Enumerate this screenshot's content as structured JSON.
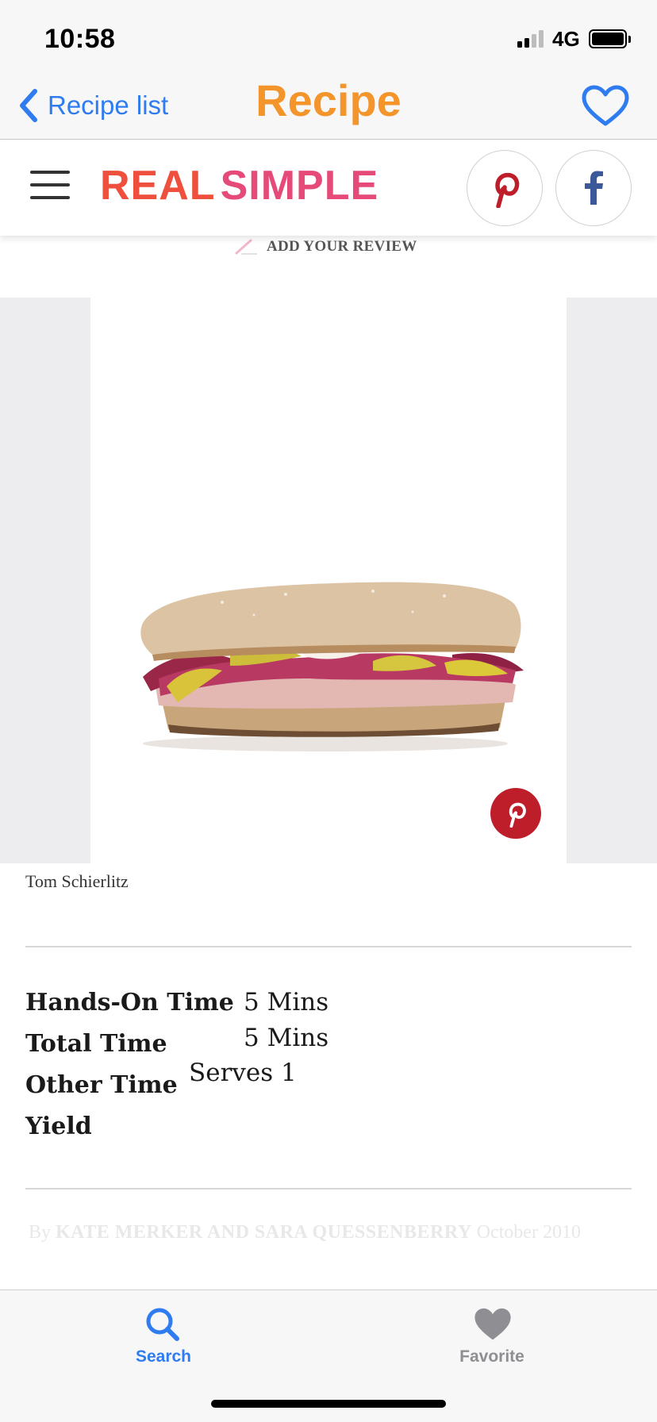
{
  "status_bar": {
    "time": "10:58",
    "network": "4G"
  },
  "nav": {
    "back_label": "Recipe list",
    "title": "Recipe"
  },
  "brand": {
    "logo_part1": "REAL",
    "logo_part2": "SIMPLE"
  },
  "review": {
    "label": "ADD YOUR REVIEW"
  },
  "photo": {
    "credit": "Tom Schierlitz"
  },
  "meta": {
    "hands_on_label": "Hands-On Time",
    "total_label": "Total Time",
    "other_label": "Other Time",
    "yield_label": "Yield",
    "hands_on_value": "5 Mins",
    "total_value": "5 Mins",
    "yield_value": "Serves 1"
  },
  "byline": {
    "prefix": "By",
    "authors": "KATE MERKER AND SARA QUESSENBERRY",
    "date": "October 2010"
  },
  "tabs": [
    {
      "label": "Search",
      "icon": "search-icon"
    },
    {
      "label": "Favorite",
      "icon": "heart-icon"
    }
  ],
  "colors": {
    "ios_blue": "#2f7cf0",
    "title_orange": "#f4952b",
    "brand_red": "#ef4f3d",
    "brand_pink": "#e54a78",
    "pinterest_red": "#bd1e2a",
    "facebook_blue": "#3b5998",
    "tab_inactive": "#8e8e93"
  }
}
